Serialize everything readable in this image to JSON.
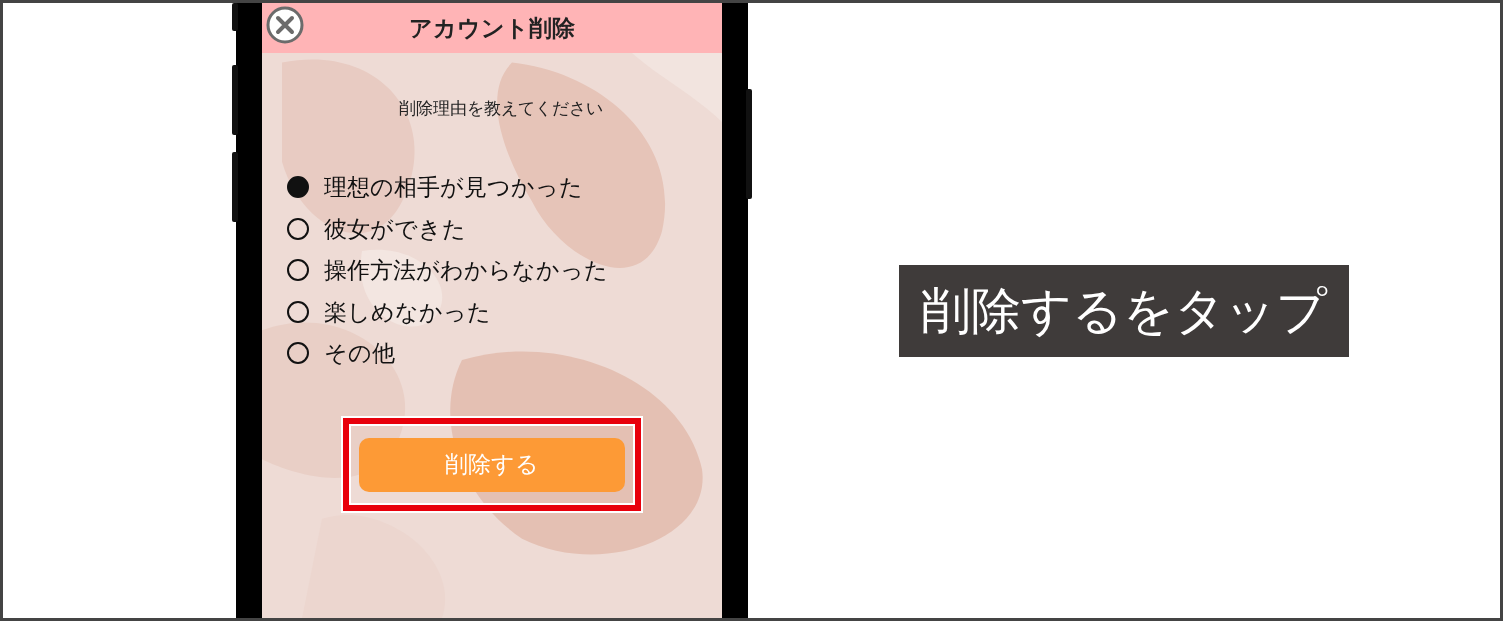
{
  "header": {
    "title": "アカウント削除"
  },
  "prompt": "削除理由を教えてください",
  "reasons": [
    {
      "label": "理想の相手が見つかった",
      "selected": true
    },
    {
      "label": "彼女ができた",
      "selected": false
    },
    {
      "label": "操作方法がわからなかった",
      "selected": false
    },
    {
      "label": "楽しめなかった",
      "selected": false
    },
    {
      "label": "その他",
      "selected": false
    }
  ],
  "delete_button": {
    "label": "削除する",
    "highlighted": true
  },
  "callout": "削除するをタップ"
}
